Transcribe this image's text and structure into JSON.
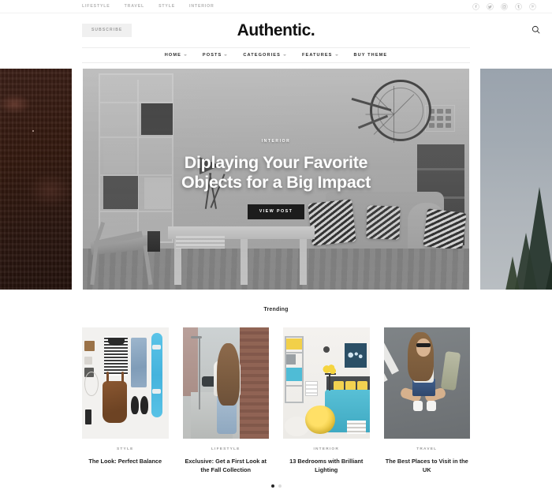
{
  "topbar": {
    "links": [
      {
        "label": "LIFESTYLE"
      },
      {
        "label": "TRAVEL"
      },
      {
        "label": "STYLE"
      },
      {
        "label": "INTERIOR"
      }
    ],
    "socials": [
      {
        "name": "facebook-icon",
        "glyph": "f"
      },
      {
        "name": "twitter-icon",
        "glyph": "t"
      },
      {
        "name": "instagram-icon",
        "glyph": "ig"
      },
      {
        "name": "tumblr-icon",
        "glyph": "tu"
      },
      {
        "name": "pinterest-icon",
        "glyph": "p"
      }
    ]
  },
  "header": {
    "subscribe_label": "SUBSCRIBE",
    "brand": "Authentic.",
    "search_name": "search-icon"
  },
  "mainnav": {
    "items": [
      {
        "label": "HOME",
        "has_caret": true
      },
      {
        "label": "POSTS",
        "has_caret": true
      },
      {
        "label": "CATEGORIES",
        "has_caret": true
      },
      {
        "label": "FEATURES",
        "has_caret": true
      },
      {
        "label": "BUY THEME",
        "has_caret": false
      }
    ]
  },
  "slider": {
    "prev_alt": "dark brick textured photo",
    "next_alt": "misty sky with fir trees photo",
    "hero": {
      "category": "INTERIOR",
      "title": "Diplaying Your Favorite Objects for a Big Impact",
      "button_label": "VIEW POST"
    }
  },
  "trending": {
    "heading": "Trending",
    "cards": [
      {
        "category": "STYLE",
        "title": "The Look: Perfect Balance",
        "image_alt": "flatlay of striped shirt jeans skateboard and brown backpack"
      },
      {
        "category": "LIFESTYLE",
        "title": "Exclusive: Get a First Look at the Fall Collection",
        "image_alt": "woman with long hair walking on city street"
      },
      {
        "category": "INTERIOR",
        "title": "13 Bedrooms with Brilliant Lighting",
        "image_alt": "bedroom with yellow pouf and teal bed"
      },
      {
        "category": "TRAVEL",
        "title": "The Best Places to Visit in the UK",
        "image_alt": "woman sitting on asphalt road with white stripes"
      }
    ],
    "dots": [
      {
        "active": true
      },
      {
        "active": false
      }
    ]
  },
  "colors": {
    "accent_dark": "#1c1c1c",
    "muted_text": "#9a9a9a",
    "topbar_text": "#b3b3b3",
    "subscribe_bg": "#f0f0f0"
  }
}
